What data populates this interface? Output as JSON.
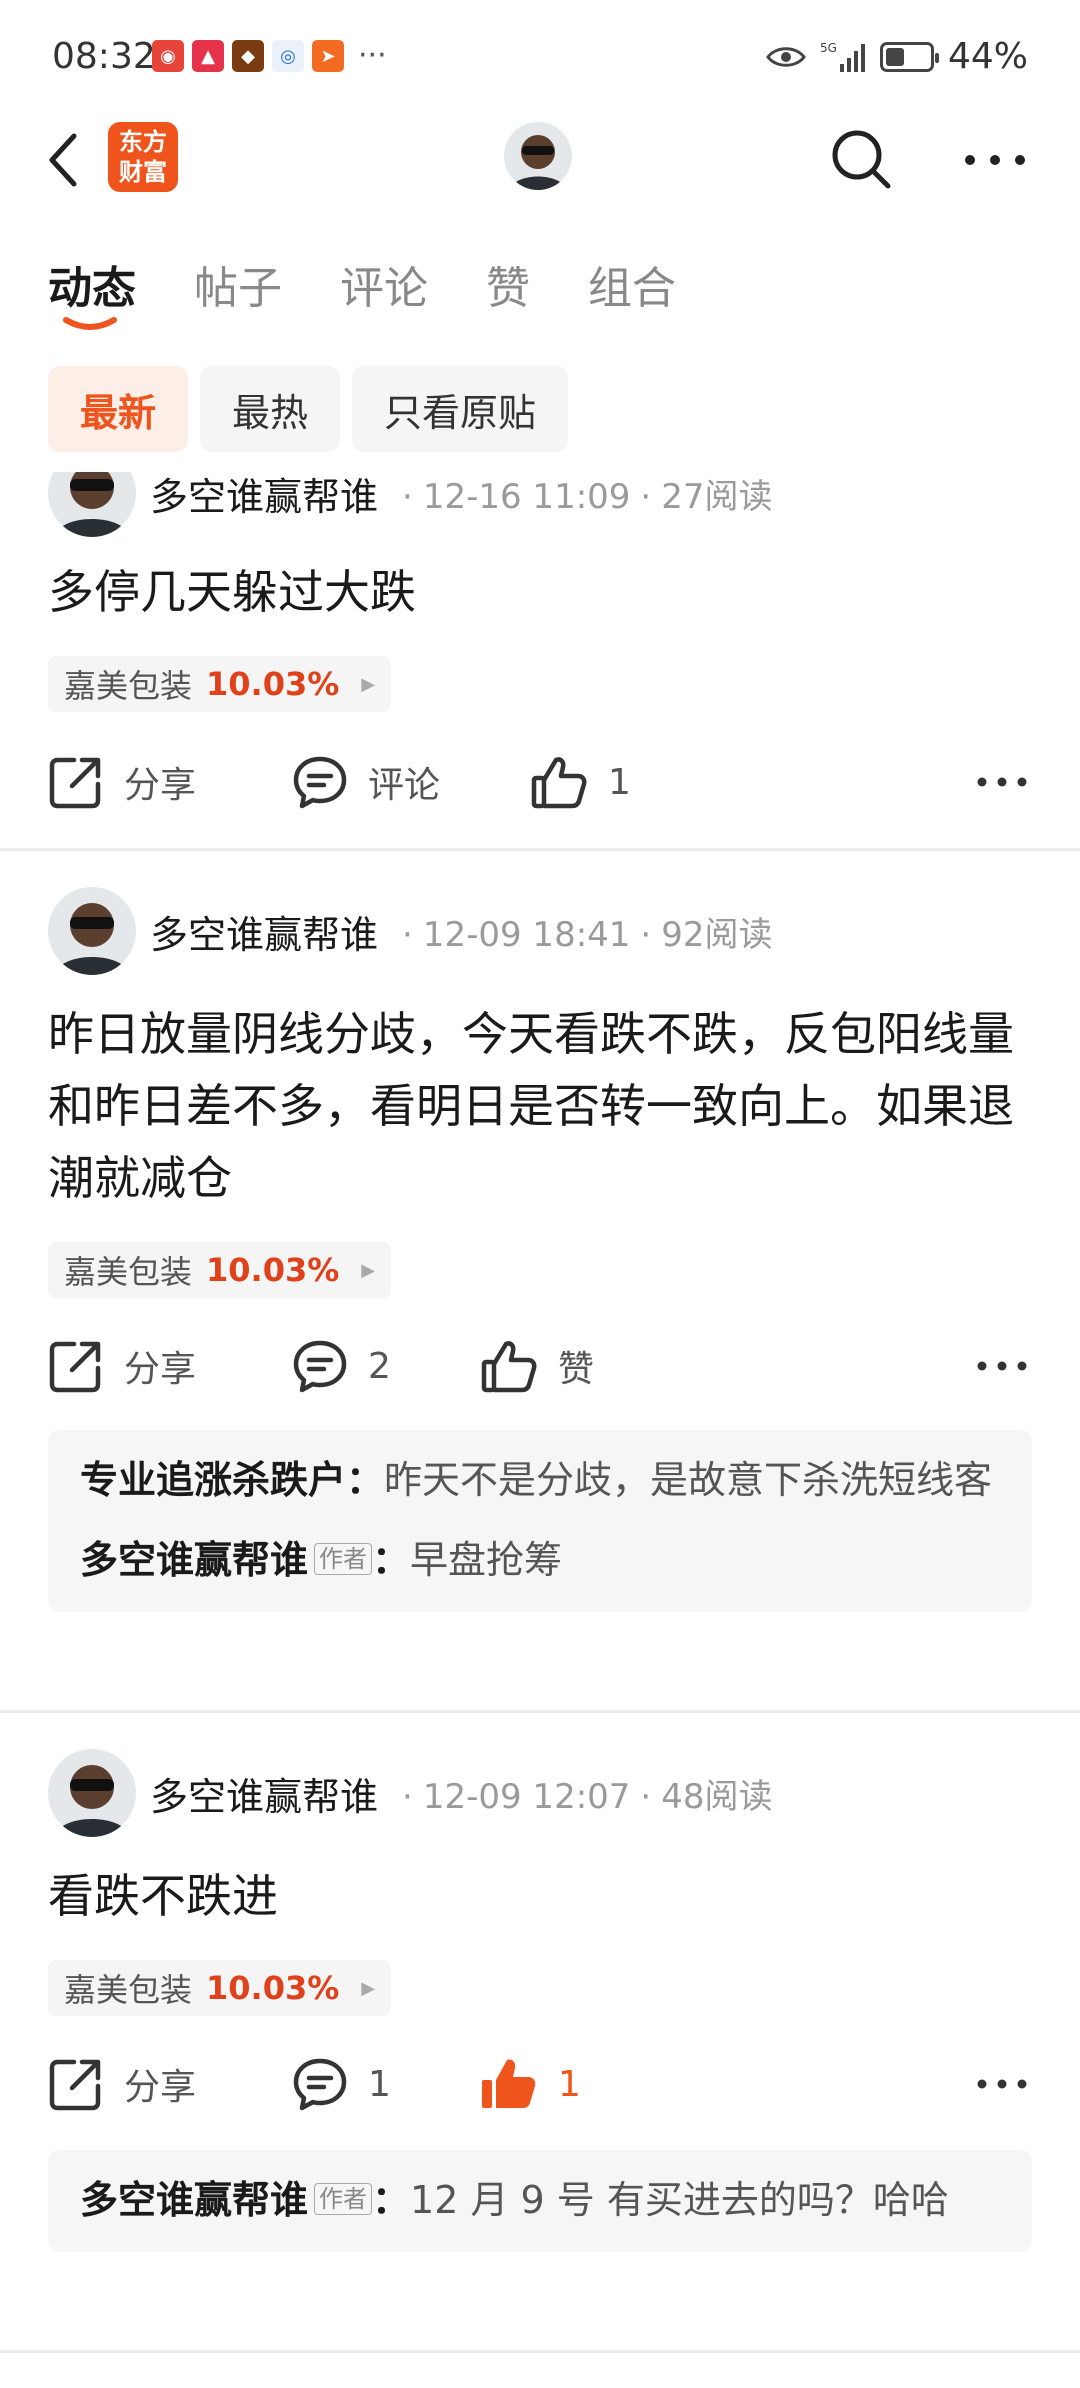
{
  "status_bar": {
    "time": "08:32",
    "battery": "44%",
    "battery_level": 0.44,
    "network": "5G"
  },
  "nav": {
    "logo_line1": "东方",
    "logo_line2": "财富"
  },
  "tabs": [
    {
      "label": "动态",
      "active": true
    },
    {
      "label": "帖子",
      "active": false
    },
    {
      "label": "评论",
      "active": false
    },
    {
      "label": "赞",
      "active": false
    },
    {
      "label": "组合",
      "active": false
    }
  ],
  "filters": [
    {
      "label": "最新",
      "active": true
    },
    {
      "label": "最热",
      "active": false
    },
    {
      "label": "只看原贴",
      "active": false
    }
  ],
  "colors": {
    "accent": "#f0541d",
    "stock_up": "#e0401a"
  },
  "posts": [
    {
      "author": "多空谁赢帮谁",
      "date": "12-16 11:09",
      "reads": "27阅读",
      "body": "多停几天躲过大跌",
      "stock_name": "嘉美包装",
      "stock_pct": "10.03%",
      "share_label": "分享",
      "comment_label": "评论",
      "like_label": "1",
      "liked": false,
      "comments": []
    },
    {
      "author": "多空谁赢帮谁",
      "date": "12-09 18:41",
      "reads": "92阅读",
      "body": "昨日放量阴线分歧，今天看跌不跌，反包阳线量和昨日差不多，看明日是否转一致向上。如果退潮就减仓",
      "stock_name": "嘉美包装",
      "stock_pct": "10.03%",
      "share_label": "分享",
      "comment_label": "2",
      "like_label": "赞",
      "liked": false,
      "comments": [
        {
          "author": "专业追涨杀跌户",
          "is_author": false,
          "sep": "：",
          "text": "昨天不是分歧，是故意下杀洗短线客"
        },
        {
          "author": "多空谁赢帮谁",
          "is_author": true,
          "badge": "作者",
          "sep": "：",
          "text": "早盘抢筹"
        }
      ]
    },
    {
      "author": "多空谁赢帮谁",
      "date": "12-09 12:07",
      "reads": "48阅读",
      "body": "看跌不跌进",
      "stock_name": "嘉美包装",
      "stock_pct": "10.03%",
      "share_label": "分享",
      "comment_label": "1",
      "like_label": "1",
      "liked": true,
      "comments": [
        {
          "author": "多空谁赢帮谁",
          "is_author": true,
          "badge": "作者",
          "sep": "：",
          "text": "12 月 9 号 有买进去的吗？哈哈"
        }
      ]
    }
  ]
}
